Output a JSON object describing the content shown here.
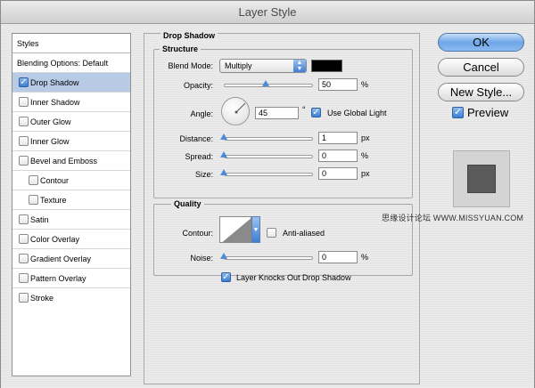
{
  "window": {
    "title": "Layer Style"
  },
  "styles_list": {
    "header": "Styles",
    "blending_options": "Blending Options: Default",
    "items": [
      {
        "label": "Drop Shadow",
        "checked": true,
        "selected": true
      },
      {
        "label": "Inner Shadow",
        "checked": false
      },
      {
        "label": "Outer Glow",
        "checked": false
      },
      {
        "label": "Inner Glow",
        "checked": false
      },
      {
        "label": "Bevel and Emboss",
        "checked": false
      },
      {
        "label": "Contour",
        "checked": false
      },
      {
        "label": "Texture",
        "checked": false
      },
      {
        "label": "Satin",
        "checked": false
      },
      {
        "label": "Color Overlay",
        "checked": false
      },
      {
        "label": "Gradient Overlay",
        "checked": false
      },
      {
        "label": "Pattern Overlay",
        "checked": false
      },
      {
        "label": "Stroke",
        "checked": false
      }
    ]
  },
  "drop_shadow": {
    "title": "Drop Shadow",
    "structure_title": "Structure",
    "blend_mode_label": "Blend Mode:",
    "blend_mode_value": "Multiply",
    "shadow_color": "#000000",
    "opacity_label": "Opacity:",
    "opacity_value": "50",
    "opacity_unit": "%",
    "angle_label": "Angle:",
    "angle_value": "45",
    "angle_unit": "°",
    "use_global_light_label": "Use Global Light",
    "use_global_light_checked": true,
    "distance_label": "Distance:",
    "distance_value": "1",
    "distance_unit": "px",
    "spread_label": "Spread:",
    "spread_value": "0",
    "spread_unit": "%",
    "size_label": "Size:",
    "size_value": "0",
    "size_unit": "px",
    "quality_title": "Quality",
    "contour_label": "Contour:",
    "anti_aliased_label": "Anti-aliased",
    "anti_aliased_checked": false,
    "noise_label": "Noise:",
    "noise_value": "0",
    "noise_unit": "%",
    "knockout_label": "Layer Knocks Out Drop Shadow",
    "knockout_checked": true
  },
  "buttons": {
    "ok": "OK",
    "cancel": "Cancel",
    "new_style": "New Style...",
    "preview_label": "Preview",
    "preview_checked": true
  },
  "watermark": "思缘设计论坛 WWW.MISSYUAN.COM"
}
